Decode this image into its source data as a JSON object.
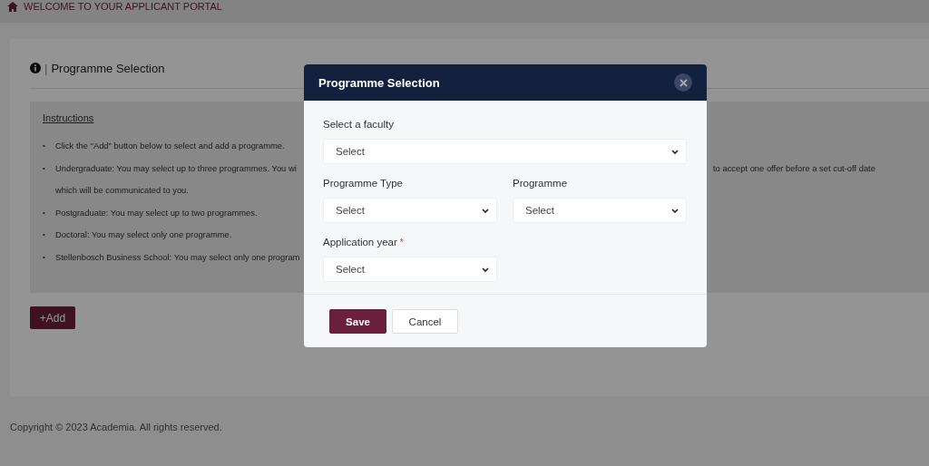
{
  "header": {
    "title": "WELCOME TO YOUR APPLICANT PORTAL"
  },
  "card": {
    "title": "Programme Selection",
    "separator": "|",
    "instructions": {
      "heading": "Instructions",
      "items": [
        {
          "bullet": "•",
          "text": "Click the \"Add\" button below to select and add a programme."
        },
        {
          "bullet": "•",
          "text": "Undergraduate: You may select up to three programmes. You wi",
          "text_right": "to accept one offer before a set cut-off date",
          "continuation": "which will be communicated to you."
        },
        {
          "bullet": "•",
          "text": "Postgraduate: You may select up to two programmes."
        },
        {
          "bullet": "•",
          "text": "Doctoral: You may select only one programme."
        },
        {
          "bullet": "•",
          "text": "Stellenbosch Business School: You may select only one program"
        }
      ]
    },
    "add_button": "+Add"
  },
  "footer": "Copyright © 2023 Academia. All rights reserved.",
  "modal": {
    "title": "Programme Selection",
    "field_rows": [
      [
        {
          "label": "Select a faculty",
          "value": "Select"
        }
      ],
      [
        {
          "label": "Programme Type",
          "value": "Select"
        },
        {
          "label": "Programme",
          "value": "Select"
        }
      ],
      [
        {
          "label": "Application year",
          "required_mark": "*",
          "value": "Select"
        }
      ]
    ],
    "buttons": [
      {
        "label": "Save",
        "kind": "primary"
      },
      {
        "label": "Cancel",
        "kind": "secondary"
      }
    ]
  }
}
